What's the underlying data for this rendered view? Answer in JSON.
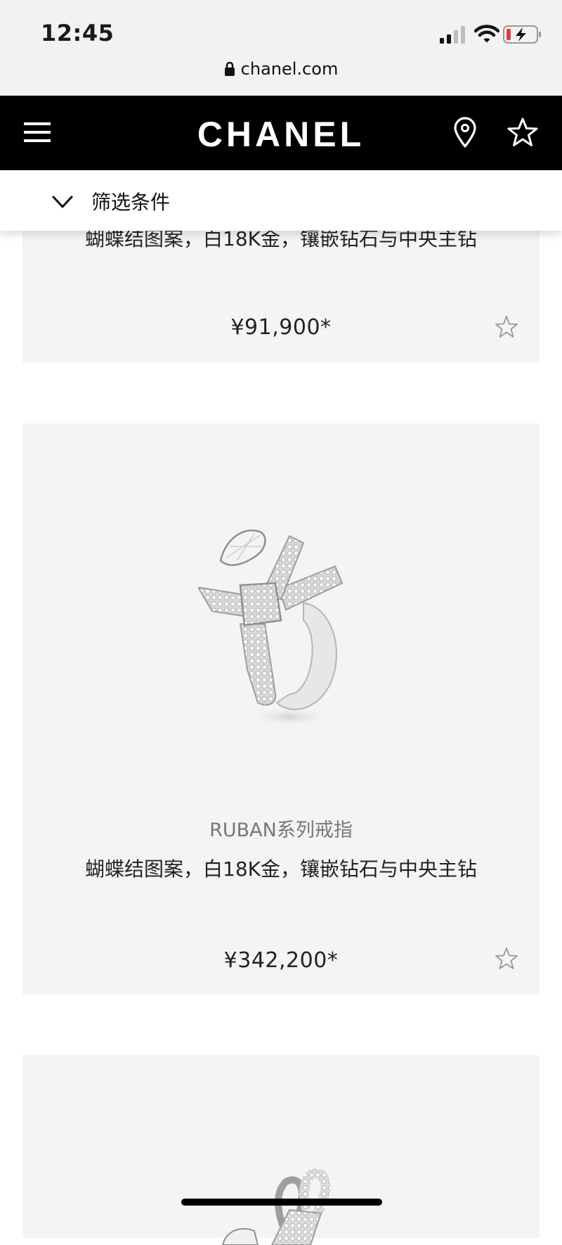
{
  "status_bar": {
    "time": "12:45",
    "url": "chanel.com"
  },
  "header": {
    "brand": "CHANEL",
    "icons": [
      "menu-icon",
      "location-pin-icon",
      "star-icon"
    ]
  },
  "filter": {
    "label": "筛选条件",
    "icon": "chevron-down-icon"
  },
  "products": [
    {
      "description": "蝴蝶结图案，白18K金，镶嵌钻石与中央主钻",
      "price": "¥91,900*"
    },
    {
      "name": "RUBAN系列戒指",
      "description": "蝴蝶结图案，白18K金，镶嵌钻石与中央主钻",
      "price": "¥342,200*"
    }
  ],
  "colors": {
    "header_bg": "#000000",
    "card_bg": "#f4f4f5",
    "status_bg": "#f2f2f2",
    "battery_low": "#e23b3b"
  }
}
